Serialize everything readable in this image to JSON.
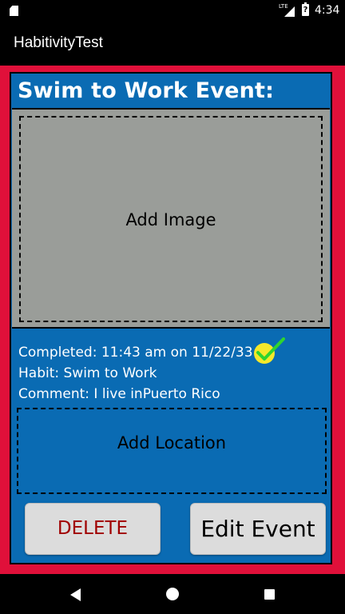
{
  "status_bar": {
    "time": "4:34",
    "network": "LTE",
    "battery_glyph": "?",
    "icons": [
      "sd-card-icon",
      "signal-icon",
      "battery-icon"
    ]
  },
  "app_bar": {
    "title": "HabitivityTest"
  },
  "event": {
    "title": "Swim to Work Event:",
    "image_placeholder": "Add Image",
    "completed": "Completed: 11:43 am on 11/22/33",
    "habit": "Habit: Swim to Work",
    "comment": "Comment: I live inPuerto Rico",
    "location_placeholder": "Add Location",
    "delete_label": "DELETE",
    "edit_label": "Edit Event"
  },
  "colors": {
    "background_red": "#e0103a",
    "panel_blue": "#0a6bb3",
    "image_gray": "#9a9d99",
    "delete_text": "#a00000",
    "check_circle": "#f5e82a",
    "check_mark": "#2fd42f"
  },
  "nav_bar": {
    "icons": [
      "back-icon",
      "home-icon",
      "recents-icon"
    ]
  }
}
